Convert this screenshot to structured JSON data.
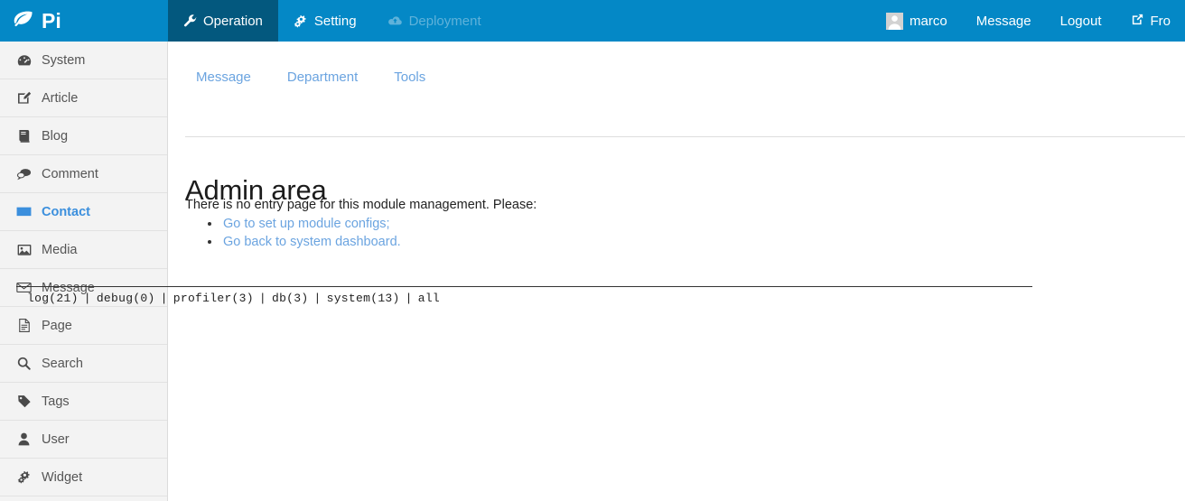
{
  "brand": {
    "text": "Pi",
    "icon": "leaf-icon"
  },
  "topnav": {
    "items": [
      {
        "label": "Operation",
        "icon": "wrench-icon",
        "state": "active"
      },
      {
        "label": "Setting",
        "icon": "gears-icon",
        "state": "normal"
      },
      {
        "label": "Deployment",
        "icon": "cloud-upload-icon",
        "state": "disabled"
      }
    ],
    "user": [
      {
        "label": "marco",
        "icon": "user-avatar-icon"
      },
      {
        "label": "Message",
        "icon": ""
      },
      {
        "label": "Logout",
        "icon": ""
      },
      {
        "label": "Fro",
        "icon": "external-link-icon"
      }
    ]
  },
  "sidebar": {
    "items": [
      {
        "label": "System",
        "icon": "dashboard-icon",
        "active": false
      },
      {
        "label": "Article",
        "icon": "edit-icon",
        "active": false
      },
      {
        "label": "Blog",
        "icon": "book-icon",
        "active": false
      },
      {
        "label": "Comment",
        "icon": "comments-icon",
        "active": false
      },
      {
        "label": "Contact",
        "icon": "envelope-icon",
        "active": true
      },
      {
        "label": "Media",
        "icon": "picture-icon",
        "active": false
      },
      {
        "label": "Message",
        "icon": "envelope-o-icon",
        "active": false
      },
      {
        "label": "Page",
        "icon": "file-text-icon",
        "active": false
      },
      {
        "label": "Search",
        "icon": "search-icon",
        "active": false
      },
      {
        "label": "Tags",
        "icon": "tag-icon",
        "active": false
      },
      {
        "label": "User",
        "icon": "user-icon",
        "active": false
      },
      {
        "label": "Widget",
        "icon": "gears-icon",
        "active": false
      }
    ]
  },
  "subtabs": [
    {
      "label": "Message"
    },
    {
      "label": "Department"
    },
    {
      "label": "Tools"
    }
  ],
  "main": {
    "title": "Admin area",
    "intro": "There is no entry page for this module management. Please:",
    "links": [
      {
        "label": "Go to set up module configs;"
      },
      {
        "label": "Go back to system dashboard."
      }
    ]
  },
  "debug": {
    "items": [
      {
        "label": "log(21)"
      },
      {
        "label": "debug(0)"
      },
      {
        "label": "profiler(3)"
      },
      {
        "label": "db(3)"
      },
      {
        "label": "system(13)"
      },
      {
        "label": "all"
      }
    ],
    "separator": "|"
  },
  "colors": {
    "header_bg": "#0488c6",
    "header_active_bg": "#03587e",
    "sidebar_bg": "#f3f3f3",
    "accent_link": "#6ba4e0",
    "active_text": "#3b8fdd"
  }
}
